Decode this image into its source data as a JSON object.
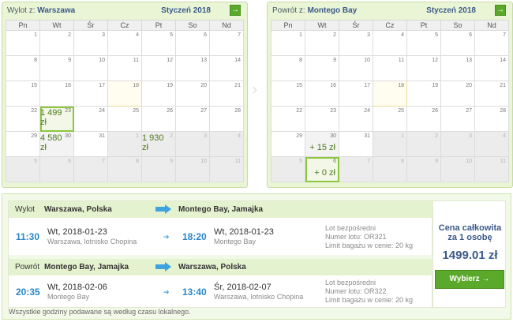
{
  "outbound_calendar": {
    "title_prefix": "Wylot z:",
    "city": "Warszawa",
    "month": "Styczeń 2018",
    "arrow_icon": "→",
    "weekdays": [
      "Pn",
      "Wt",
      "Śr",
      "Cz",
      "Pt",
      "So",
      "Nd"
    ],
    "days": [
      "1",
      "2",
      "3",
      "4",
      "5",
      "6",
      "7",
      "8",
      "9",
      "10",
      "11",
      "12",
      "13",
      "14",
      "15",
      "16",
      "17",
      "18",
      "19",
      "20",
      "21",
      "22",
      "23",
      "24",
      "25",
      "26",
      "27",
      "28",
      "29",
      "30",
      "31",
      "1",
      "2",
      "3",
      "4",
      "5",
      "6",
      "7",
      "8",
      "9",
      "10",
      "11"
    ],
    "prices": {
      "23": "1 499 zł",
      "30": "4 580 zł",
      "2": "1 930 zł"
    }
  },
  "return_calendar": {
    "title_prefix": "Powrót z:",
    "city": "Montego Bay",
    "month": "Styczeń 2018",
    "arrow_icon": "→",
    "weekdays": [
      "Pn",
      "Wt",
      "Śr",
      "Cz",
      "Pt",
      "So",
      "Nd"
    ],
    "days": [
      "1",
      "2",
      "3",
      "4",
      "5",
      "6",
      "7",
      "8",
      "9",
      "10",
      "11",
      "12",
      "13",
      "14",
      "15",
      "16",
      "17",
      "18",
      "19",
      "20",
      "21",
      "22",
      "23",
      "24",
      "25",
      "26",
      "27",
      "28",
      "29",
      "30",
      "31",
      "1",
      "2",
      "3",
      "4",
      "5",
      "6",
      "7",
      "8",
      "9",
      "10",
      "11"
    ],
    "prices": {
      "30": "+ 15 zł",
      "6": "+ 0 zł"
    }
  },
  "legs": [
    {
      "label": "Wylot",
      "from": "Warszawa, Polska",
      "to": "Montego Bay, Jamajka",
      "dep_time": "11:30",
      "dep_date": "Wt, 2018-01-23",
      "dep_place": "Warszawa, lotnisko Chopina",
      "arr_time": "18:20",
      "arr_date": "Wt, 2018-01-23",
      "arr_place": "Montego Bay",
      "info_type": "Lot bezpośredni",
      "info_number": "Numer lotu: OR321",
      "info_baggage": "Limit bagażu w cenie: 20 kg"
    },
    {
      "label": "Powrót",
      "from": "Montego Bay, Jamajka",
      "to": "Warszawa, Polska",
      "dep_time": "20:35",
      "dep_date": "Wt, 2018-02-06",
      "dep_place": "Montego Bay",
      "arr_time": "13:40",
      "arr_date": "Śr, 2018-02-07",
      "arr_place": "Warszawa, lotnisko Chopina",
      "info_type": "Lot bezpośredni",
      "info_number": "Numer lotu: OR322",
      "info_baggage": "Limit bagażu w cenie: 20 kg"
    }
  ],
  "price_box": {
    "label_line1": "Cena całkowita",
    "label_line2": "za 1 osobę",
    "total": "1499.01 zł",
    "button": "Wybierz",
    "button_icon": "→"
  },
  "footnote": "Wszystkie godziny podawane są według czasu lokalnego.",
  "colors": {
    "accent_green": "#5aa92a",
    "panel_bg": "#eaf5d6",
    "time_blue": "#2a87c9",
    "title_blue": "#3b5a8a"
  }
}
